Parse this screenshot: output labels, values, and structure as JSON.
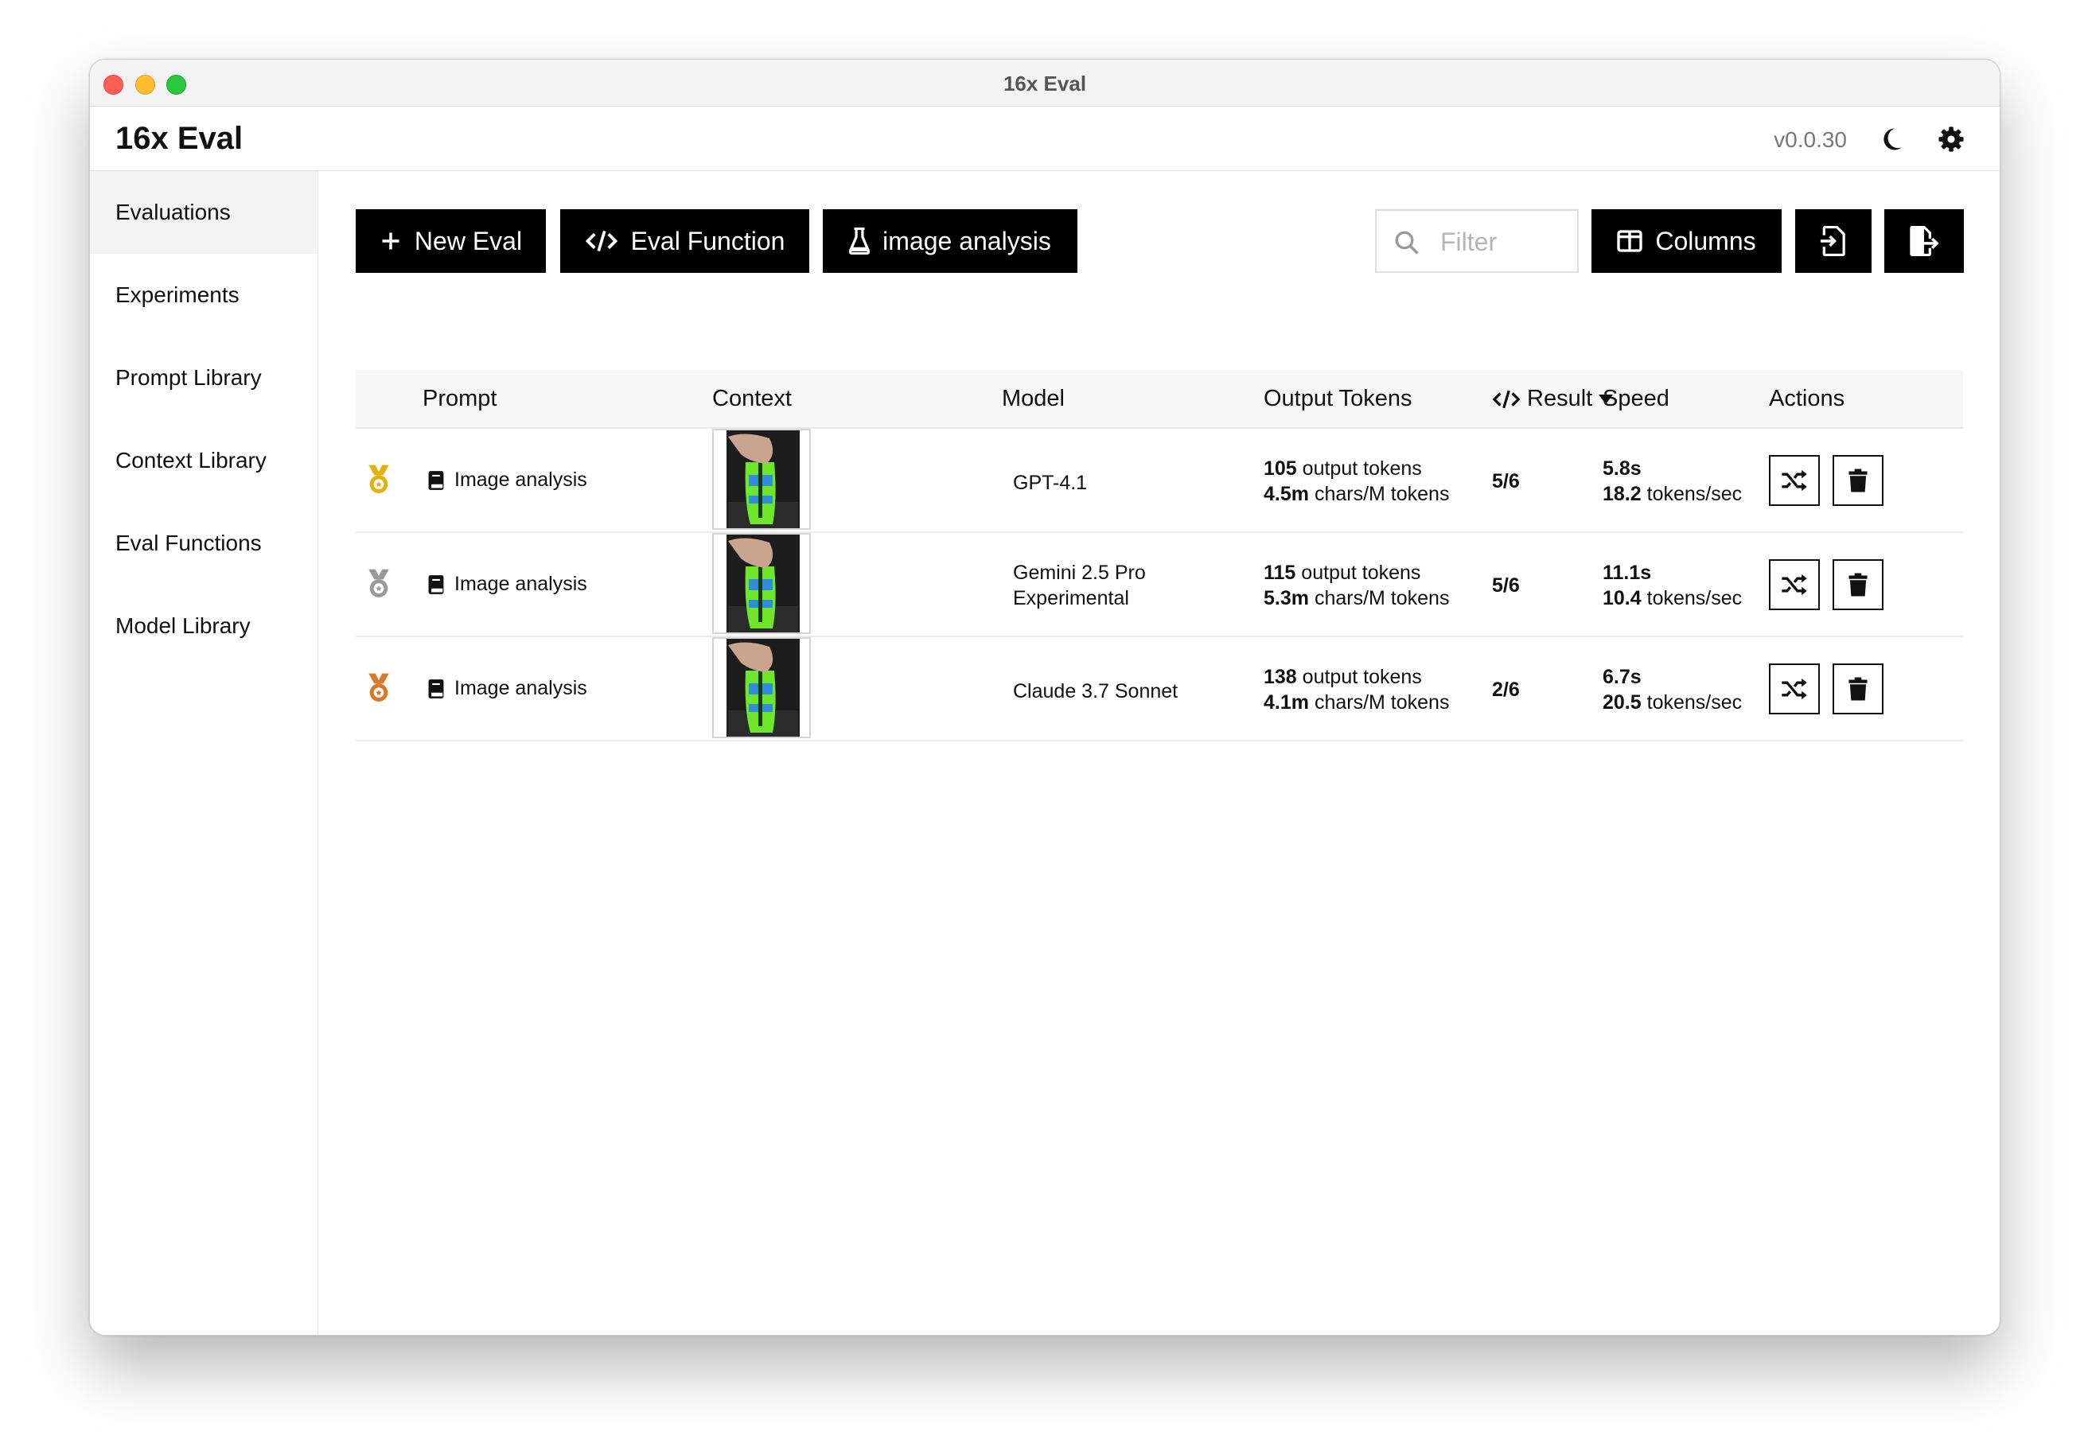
{
  "window": {
    "title": "16x Eval"
  },
  "header": {
    "app_name": "16x Eval",
    "version": "v0.0.30",
    "theme_icon": "moon-icon",
    "settings_icon": "gear-icon"
  },
  "sidebar": {
    "items": [
      {
        "label": "Evaluations",
        "active": true
      },
      {
        "label": "Experiments"
      },
      {
        "label": "Prompt Library"
      },
      {
        "label": "Context Library"
      },
      {
        "label": "Eval Functions"
      },
      {
        "label": "Model Library"
      }
    ]
  },
  "toolbar": {
    "new_eval_label": "New Eval",
    "eval_function_label": "Eval Function",
    "experiment_label": "image analysis",
    "filter_placeholder": "Filter",
    "filter_value": "",
    "columns_label": "Columns"
  },
  "table": {
    "headers": {
      "prompt": "Prompt",
      "context": "Context",
      "model": "Model",
      "output_tokens": "Output Tokens",
      "result": "Result",
      "speed": "Speed",
      "actions": "Actions"
    },
    "rows": [
      {
        "medal": "gold",
        "prompt": "Image analysis",
        "model": "GPT-4.1",
        "tokens_count": "105",
        "tokens_label": "output tokens",
        "chars_value": "4.5m",
        "chars_label": "chars/M tokens",
        "result": "5/6",
        "time": "5.8s",
        "rate": "18.2",
        "rate_label": "tokens/sec"
      },
      {
        "medal": "silver",
        "prompt": "Image analysis",
        "model": "Gemini 2.5 Pro Experimental",
        "tokens_count": "115",
        "tokens_label": "output tokens",
        "chars_value": "5.3m",
        "chars_label": "chars/M tokens",
        "result": "5/6",
        "time": "11.1s",
        "rate": "10.4",
        "rate_label": "tokens/sec"
      },
      {
        "medal": "bronze",
        "prompt": "Image analysis",
        "model": "Claude 3.7 Sonnet",
        "tokens_count": "138",
        "tokens_label": "output tokens",
        "chars_value": "4.1m",
        "chars_label": "chars/M tokens",
        "result": "2/6",
        "time": "6.7s",
        "rate": "20.5",
        "rate_label": "tokens/sec"
      }
    ]
  },
  "colors": {
    "gold": "#e3b10f",
    "silver": "#9a9a9a",
    "bronze": "#d9782a",
    "button": "#000000"
  }
}
